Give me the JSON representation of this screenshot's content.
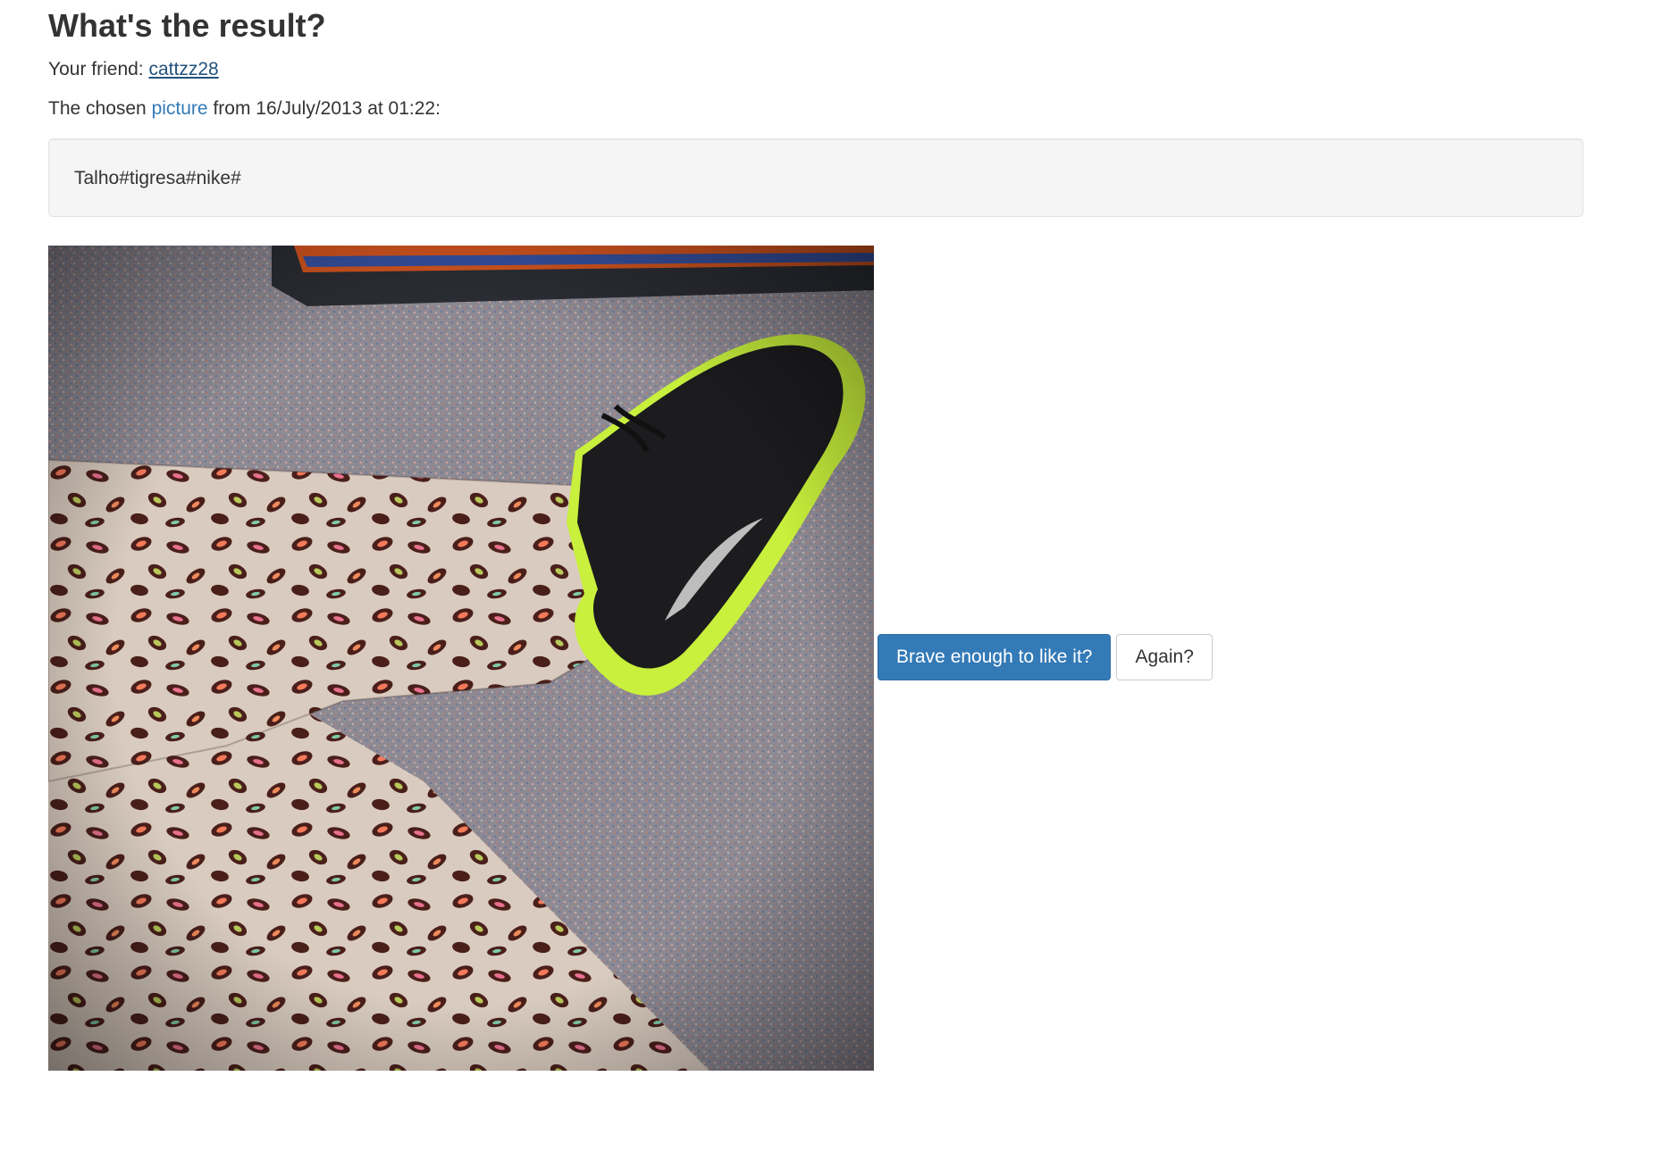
{
  "page": {
    "title": "What's the result?"
  },
  "friend": {
    "label": "Your friend: ",
    "name": "cattzz28"
  },
  "chosen": {
    "prefix": "The chosen ",
    "link_text": "picture",
    "suffix": " from 16/July/2013 at 01:22:"
  },
  "caption": {
    "text": "Talho#tigresa#nike#"
  },
  "actions": {
    "like_label": "Brave enough to like it?",
    "again_label": "Again?"
  },
  "colors": {
    "primary": "#337ab7",
    "link": "#23527c",
    "well_bg": "#f5f5f5",
    "shoe_accent": "#c8f03c"
  }
}
